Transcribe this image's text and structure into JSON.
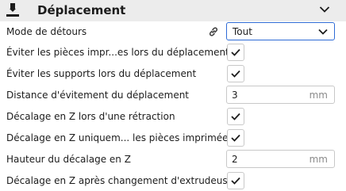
{
  "section": {
    "title": "Déplacement",
    "icon": "travel-section-icon",
    "collapse_icon": "chevron-down-icon"
  },
  "settings": {
    "combing_mode": {
      "label": "Mode de détours",
      "value": "Tout",
      "link_icon": "link-icon"
    },
    "avoid_printed_parts": {
      "label": "Éviter les pièces impr...es lors du déplacement",
      "checked": true
    },
    "avoid_supports": {
      "label": "Éviter les supports lors du déplacement",
      "checked": true
    },
    "avoid_distance": {
      "label": "Distance d'évitement du déplacement",
      "value": "3",
      "unit": "mm"
    },
    "z_hop_retract": {
      "label": "Décalage en Z lors d'une rétraction",
      "checked": true
    },
    "z_hop_only_printed": {
      "label": "Décalage en Z uniquem... les pièces imprimées",
      "checked": true
    },
    "z_hop_height": {
      "label": "Hauteur du décalage en Z",
      "value": "2",
      "unit": "mm"
    },
    "z_hop_extruder_switch": {
      "label": "Décalage en Z après changement d'extrudeuse",
      "checked": true
    }
  },
  "colors": {
    "header_bg": "#ececec",
    "accent": "#2f6bd6",
    "border": "#c8c8c8",
    "text": "#1c1c1c"
  }
}
